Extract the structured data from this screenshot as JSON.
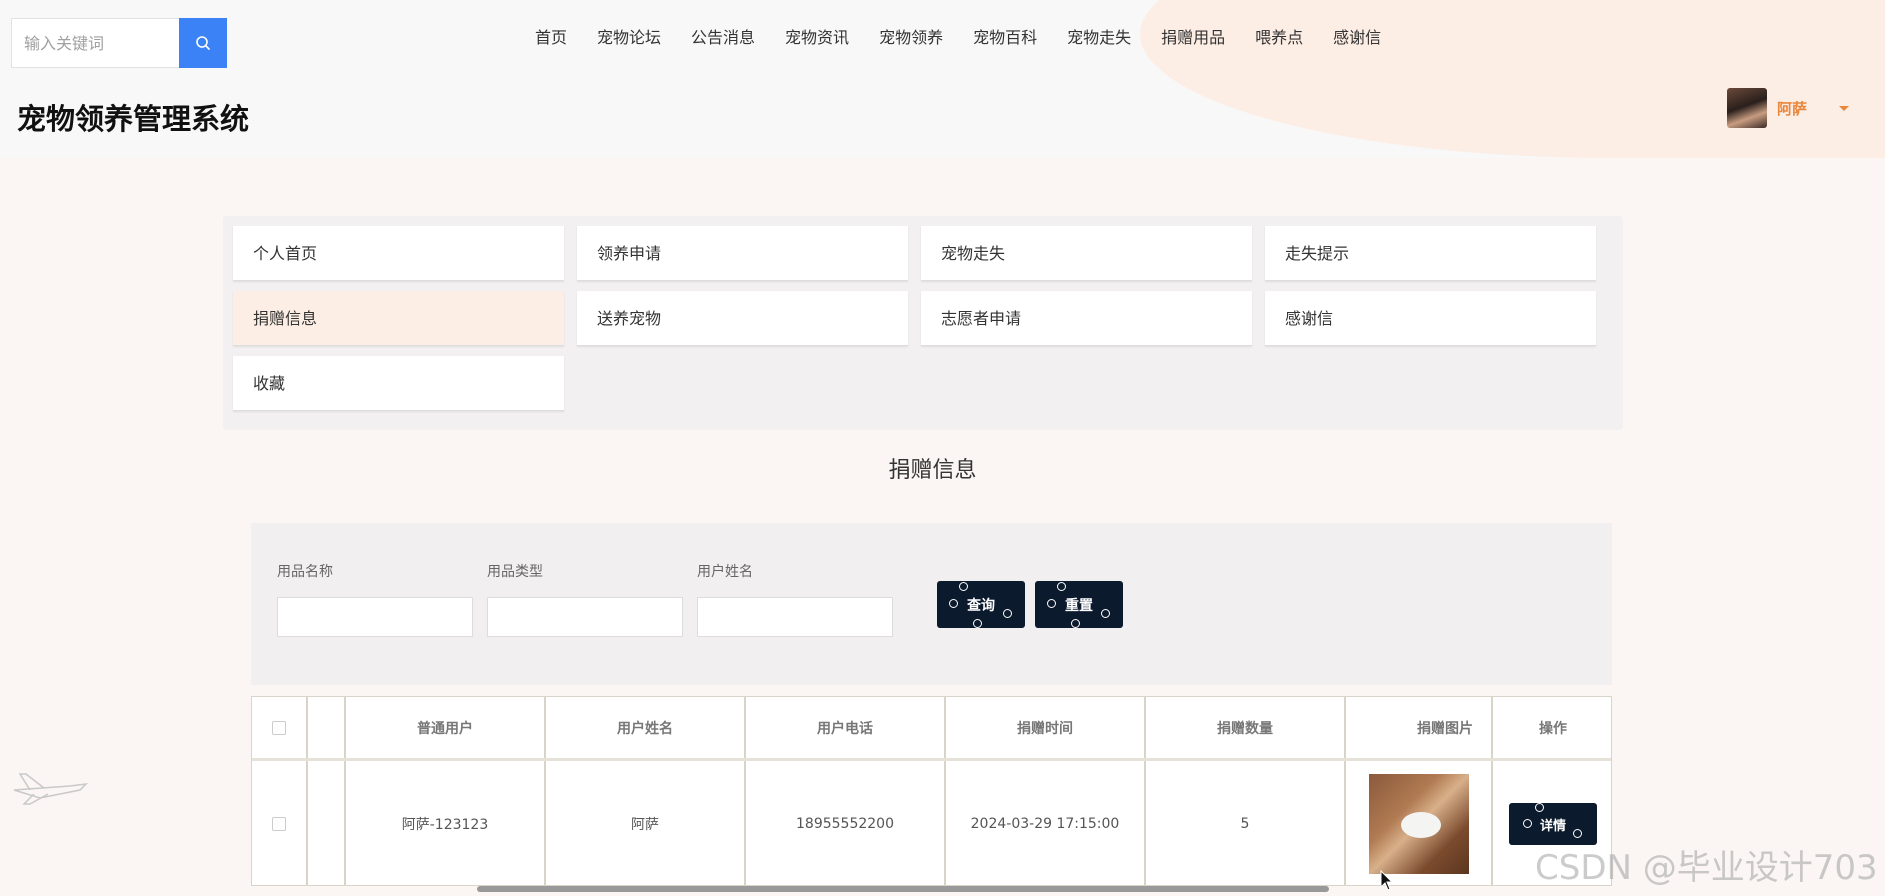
{
  "header": {
    "search_placeholder": "输入关键词",
    "nav_items": [
      "首页",
      "宠物论坛",
      "公告消息",
      "宠物资讯",
      "宠物领养",
      "宠物百科",
      "宠物走失",
      "捐赠用品",
      "喂养点",
      "感谢信"
    ],
    "site_title": "宠物领养管理系统",
    "user_name": "阿萨"
  },
  "menu": {
    "items": [
      "个人首页",
      "领养申请",
      "宠物走失",
      "走失提示",
      "捐赠信息",
      "送养宠物",
      "志愿者申请",
      "感谢信",
      "收藏"
    ],
    "active_index": 4
  },
  "section_title": "捐赠信息",
  "filters": {
    "labels": [
      "用品名称",
      "用品类型",
      "用户姓名"
    ],
    "query_label": "查询",
    "reset_label": "重置"
  },
  "table": {
    "columns": [
      "普通用户",
      "用户姓名",
      "用户电话",
      "捐赠时间",
      "捐赠数量",
      "捐赠图片",
      "操作"
    ],
    "rows": [
      {
        "account": "阿萨-123123",
        "name": "阿萨",
        "phone": "18955552200",
        "time": "2024-03-29 17:15:00",
        "quantity": "5",
        "action_label": "详情"
      }
    ]
  },
  "watermark": "CSDN @毕业设计703",
  "colors": {
    "accent_blue": "#3b82f6",
    "button_dark": "#0c1a2e",
    "active_menu_bg": "#fdeee5",
    "user_name": "#e8873c"
  }
}
